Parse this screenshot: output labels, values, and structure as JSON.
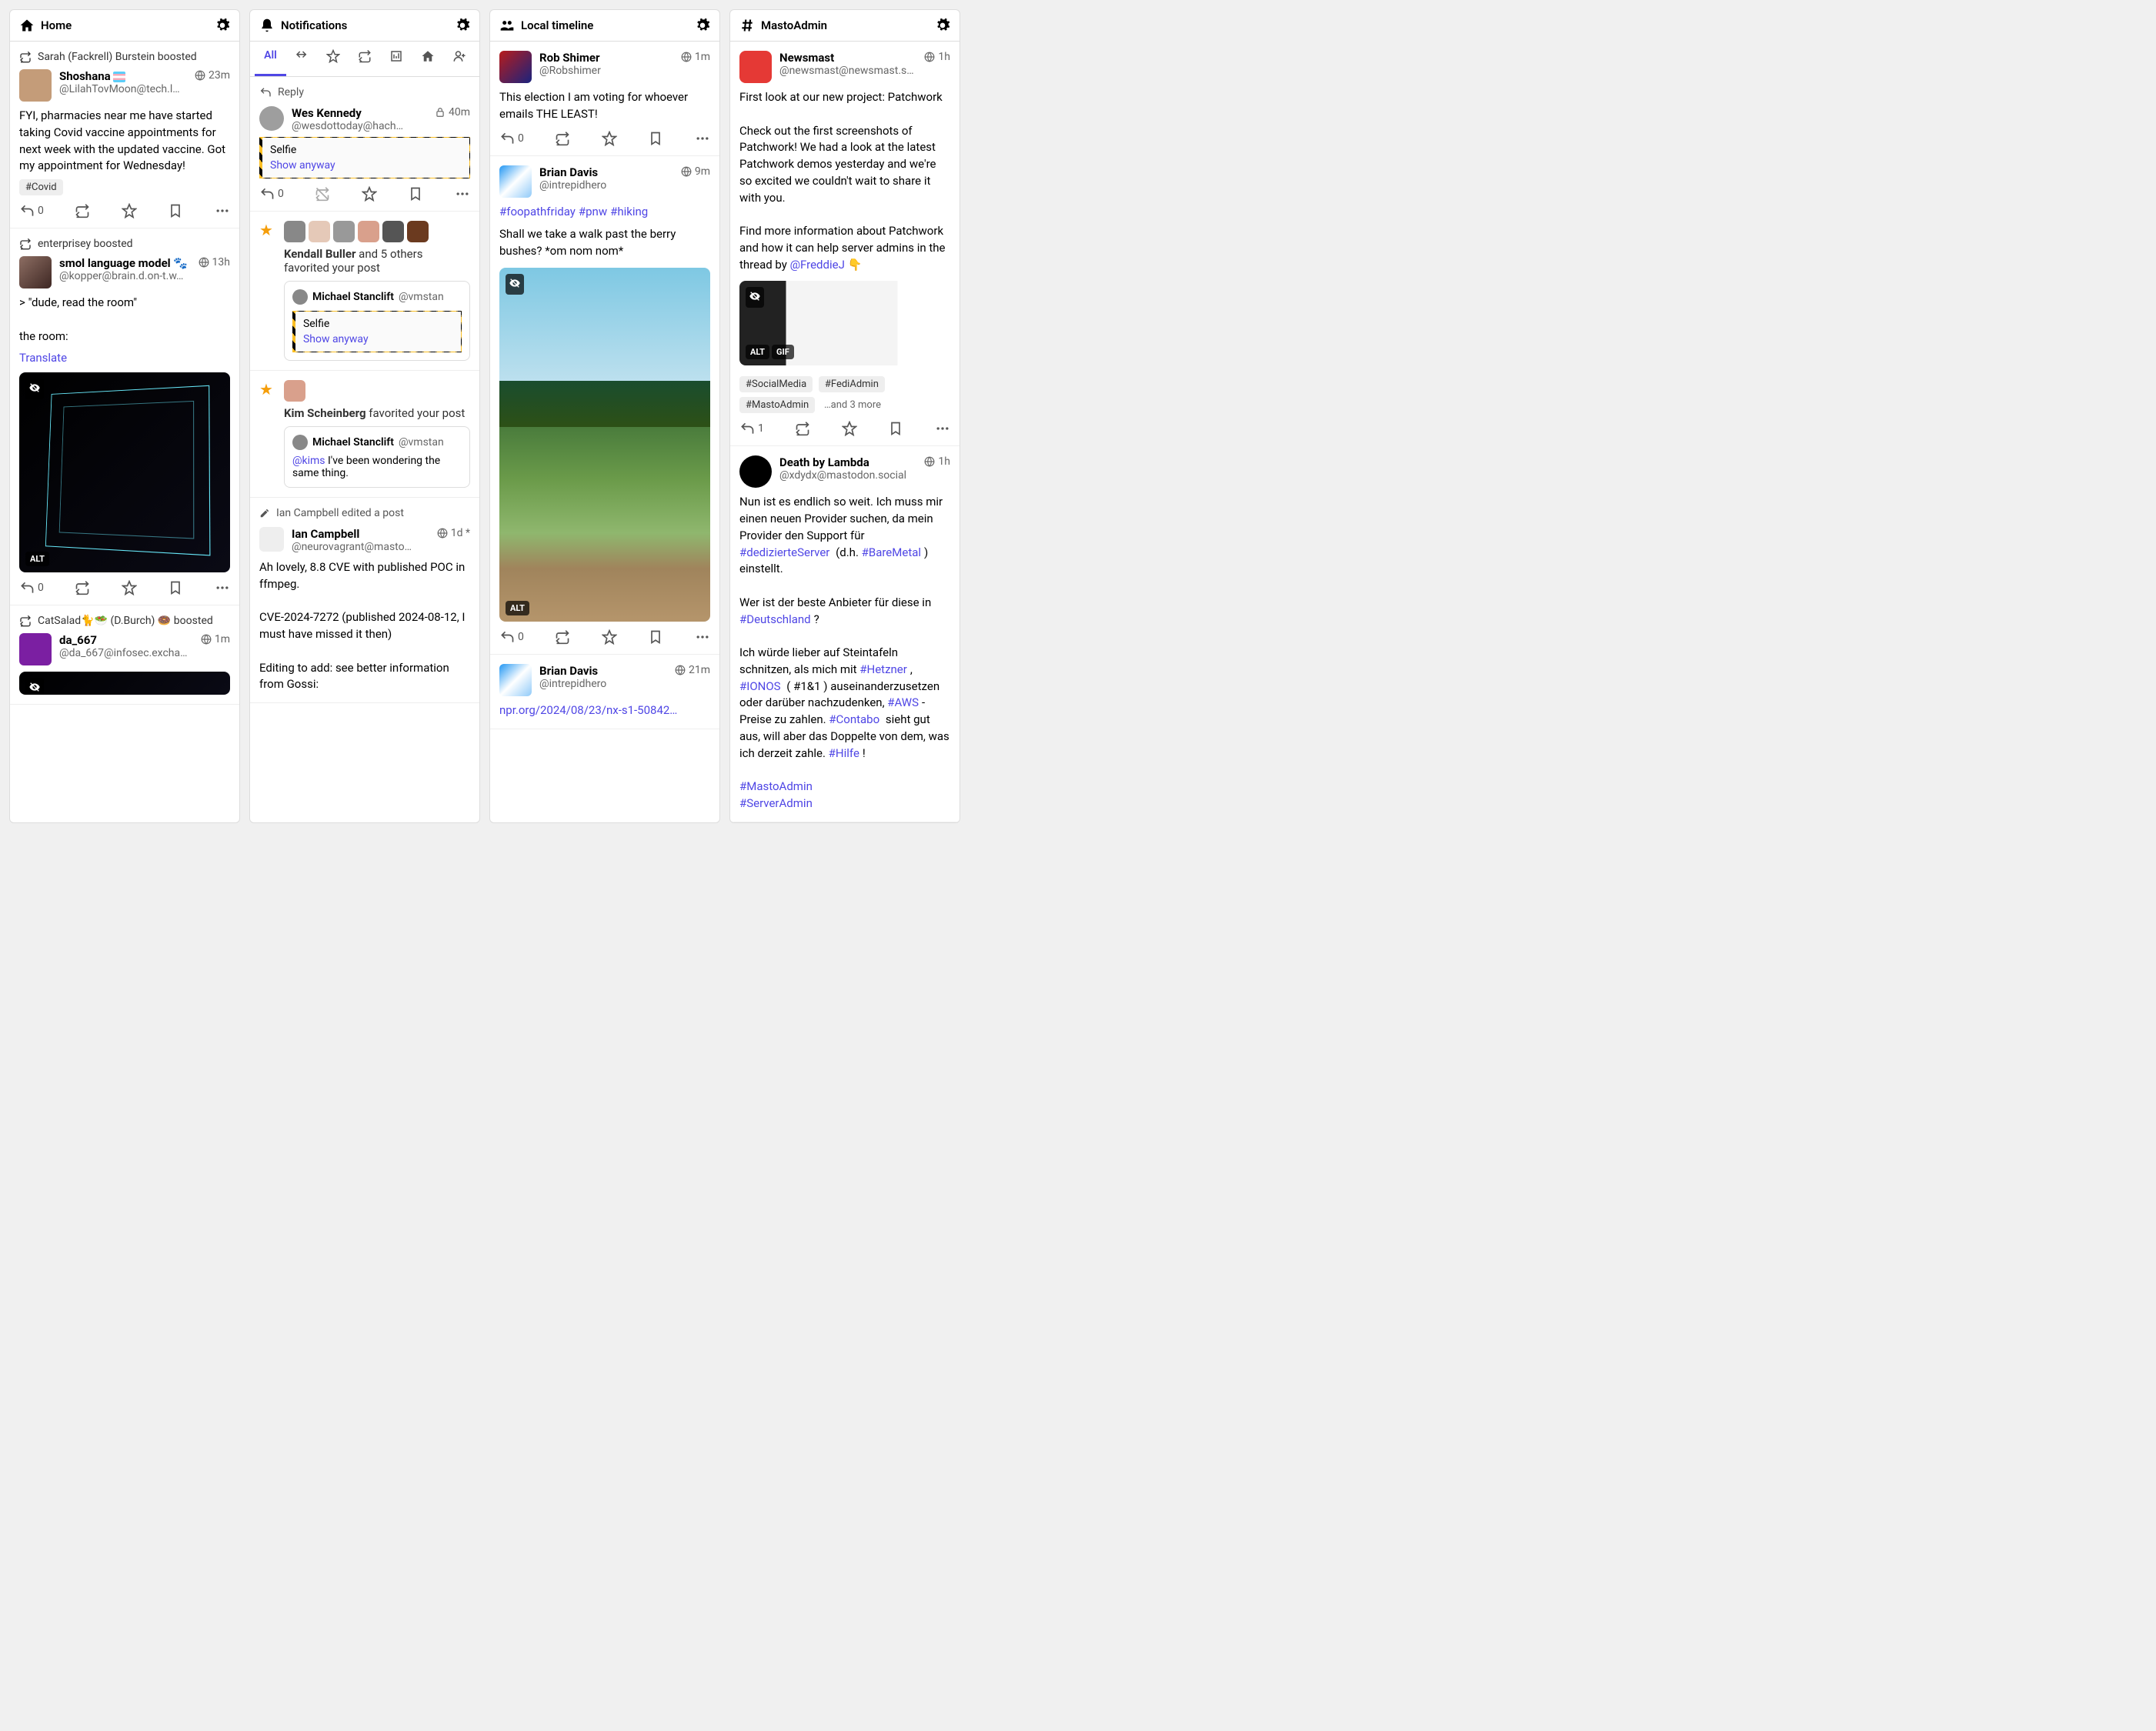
{
  "columns": {
    "home": {
      "title": "Home"
    },
    "notifications": {
      "title": "Notifications",
      "tabs": {
        "all": "All"
      }
    },
    "local": {
      "title": "Local timeline"
    },
    "mastoadmin": {
      "title": "MastoAdmin"
    }
  },
  "home": {
    "p1": {
      "boost": "Sarah (Fackrell) Burstein boosted",
      "name": "Shoshana",
      "handle": "@LilahTovMoon@tech.l…",
      "time": "23m",
      "body": "FYI, pharmacies near me have started taking Covid vaccine appointments for next week with the updated vaccine. Got my appointment for Wednesday!",
      "tag": "#Covid",
      "replies": "0"
    },
    "p2": {
      "boost": "enterprisey boosted",
      "name": "smol language model",
      "handle": "@kopper@brain.d.on-t.w…",
      "time": "13h",
      "l1": "> \"dude, read the room\"",
      "l2": "the room:",
      "translate": "Translate",
      "alt": "ALT",
      "replies": "0"
    },
    "p3": {
      "boost": "CatSalad🐈🥗 (D.Burch) 🍩 boosted",
      "name": "da_667",
      "handle": "@da_667@infosec.excha…",
      "time": "1m"
    }
  },
  "notif": {
    "reply": {
      "label": "Reply",
      "name": "Wes Kennedy",
      "handle": "@wesdottoday@hach…",
      "time": "40m",
      "cw": "Selfie",
      "show": "Show anyway",
      "replies": "0"
    },
    "fav1": {
      "who": "Kendall Buller",
      "rest": " and 5 others favorited your post",
      "qname": "Michael Stanclift",
      "qhandle": "@vmstan",
      "cw": "Selfie",
      "show": "Show anyway"
    },
    "fav2": {
      "who": "Kim Scheinberg",
      "rest": " favorited your post",
      "qname": "Michael Stanclift",
      "qhandle": "@vmstan",
      "mention": "@kims",
      "body": " I've been wondering the same thing."
    },
    "edit": {
      "label": "Ian Campbell edited a post",
      "name": "Ian Campbell",
      "handle": "@neurovagrant@masto…",
      "time": "1d *",
      "b1": "Ah lovely, 8.8 CVE with published POC in ffmpeg.",
      "b2": "CVE-2024-7272 (published 2024-08-12, I must have missed it then)",
      "b3": "Editing to add: see better information from Gossi:"
    }
  },
  "local": {
    "p1": {
      "name": "Rob Shimer",
      "handle": "@Robshimer",
      "time": "1m",
      "body": "This election I am voting for whoever emails THE LEAST!",
      "replies": "0"
    },
    "p2": {
      "name": "Brian Davis",
      "handle": "@intrepidhero",
      "time": "9m",
      "h1": "#foopathfriday",
      "h2": "#pnw",
      "h3": "#hiking",
      "body": "Shall we take a walk past the berry bushes? *om nom nom*",
      "alt": "ALT",
      "replies": "0"
    },
    "p3": {
      "name": "Brian Davis",
      "handle": "@intrepidhero",
      "time": "21m",
      "link": "npr.org/2024/08/23/nx-s1-50842…"
    }
  },
  "masto": {
    "p1": {
      "name": "Newsmast",
      "handle": "@newsmast@newsmast.s…",
      "time": "1h",
      "b1": "First look at our new project: Patchwork",
      "b2": "Check out the first screenshots of Patchwork! We had a look at the latest Patchwork demos yesterday and we're so excited we couldn't wait to share it with you.",
      "b3a": "Find more information about Patchwork and how it can help server admins in the thread by ",
      "b3link": "@FreddieJ",
      "b3b": " 👇",
      "alt": "ALT",
      "gif": "GIF",
      "t1": "#SocialMedia",
      "t2": "#FediAdmin",
      "t3": "#MastoAdmin",
      "more": "…and 3 more",
      "replies": "1"
    },
    "p2": {
      "name": "Death by Lambda",
      "handle": "@xdydx@mastodon.social",
      "time": "1h",
      "s1a": "Nun ist es endlich so weit.  Ich muss mir einen neuen Provider suchen, da mein Provider den Support für ",
      "h1": "#dedizierteServer",
      "s1b": " (d.h. ",
      "h2": "#BareMetal",
      "s1c": ") einstellt.",
      "s2a": "Wer ist der beste Anbieter für diese in ",
      "h3": "#Deutschland",
      "s2b": "?",
      "s3a": "Ich würde lieber auf Steintafeln schnitzen, als mich mit ",
      "h4": "#Hetzner",
      "s3b": ", ",
      "h5": "#IONOS",
      "s3c": " ( #1&1 ) auseinanderzusetzen oder darüber nachzudenken, ",
      "h6": "#AWS",
      "s3d": "-Preise zu zahlen. ",
      "h7": "#Contabo",
      "s3e": " sieht gut aus, will aber das Doppelte von dem, was ich derzeit zahle. ",
      "h8": "#Hilfe",
      "s3f": "!",
      "h9": "#MastoAdmin",
      "h10": "#ServerAdmin"
    }
  }
}
